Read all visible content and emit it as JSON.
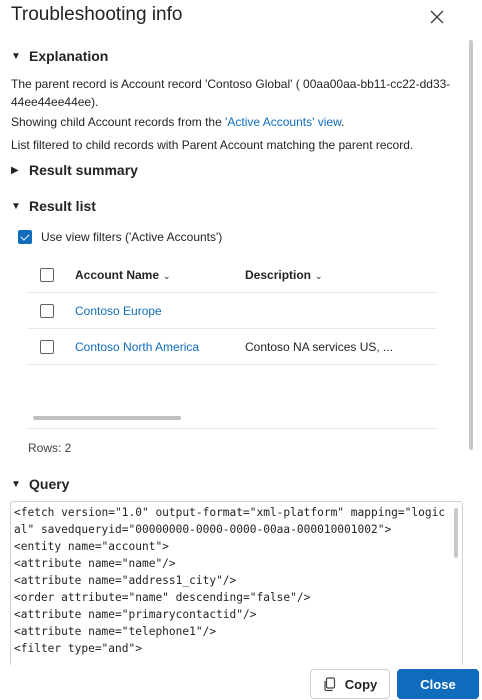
{
  "dialog": {
    "title": "Troubleshooting info",
    "close_icon": "close-icon"
  },
  "explanation": {
    "heading": "Explanation",
    "line1": "The parent record is Account record 'Contoso Global' ( 00aa00aa-bb11-cc22-dd33-44ee44ee44ee).",
    "line2_prefix": "Showing child Account records from the ",
    "line2_link": "'Active Accounts' view",
    "line2_suffix": ".",
    "line3": "List filtered to child records with Parent Account matching the parent record."
  },
  "result_summary": {
    "heading": "Result summary"
  },
  "result_list": {
    "heading": "Result list",
    "view_filter_label": "Use view filters ('Active Accounts')",
    "view_filter_checked": true,
    "columns": [
      "Account Name",
      "Description"
    ],
    "rows": [
      {
        "name": "Contoso Europe",
        "description": ""
      },
      {
        "name": "Contoso North America",
        "description": "Contoso NA services US, ..."
      }
    ],
    "rows_count": "Rows: 2"
  },
  "query": {
    "heading": "Query",
    "text": "<fetch version=\"1.0\" output-format=\"xml-platform\" mapping=\"logical\" savedqueryid=\"00000000-0000-0000-00aa-000010001002\">\n<entity name=\"account\">\n<attribute name=\"name\"/>\n<attribute name=\"address1_city\"/>\n<order attribute=\"name\" descending=\"false\"/>\n<attribute name=\"primarycontactid\"/>\n<attribute name=\"telephone1\"/>\n<filter type=\"and\">"
  },
  "footer": {
    "copy_label": "Copy",
    "close_label": "Close"
  },
  "colors": {
    "accent": "#0f6cbd",
    "text": "#242424"
  }
}
